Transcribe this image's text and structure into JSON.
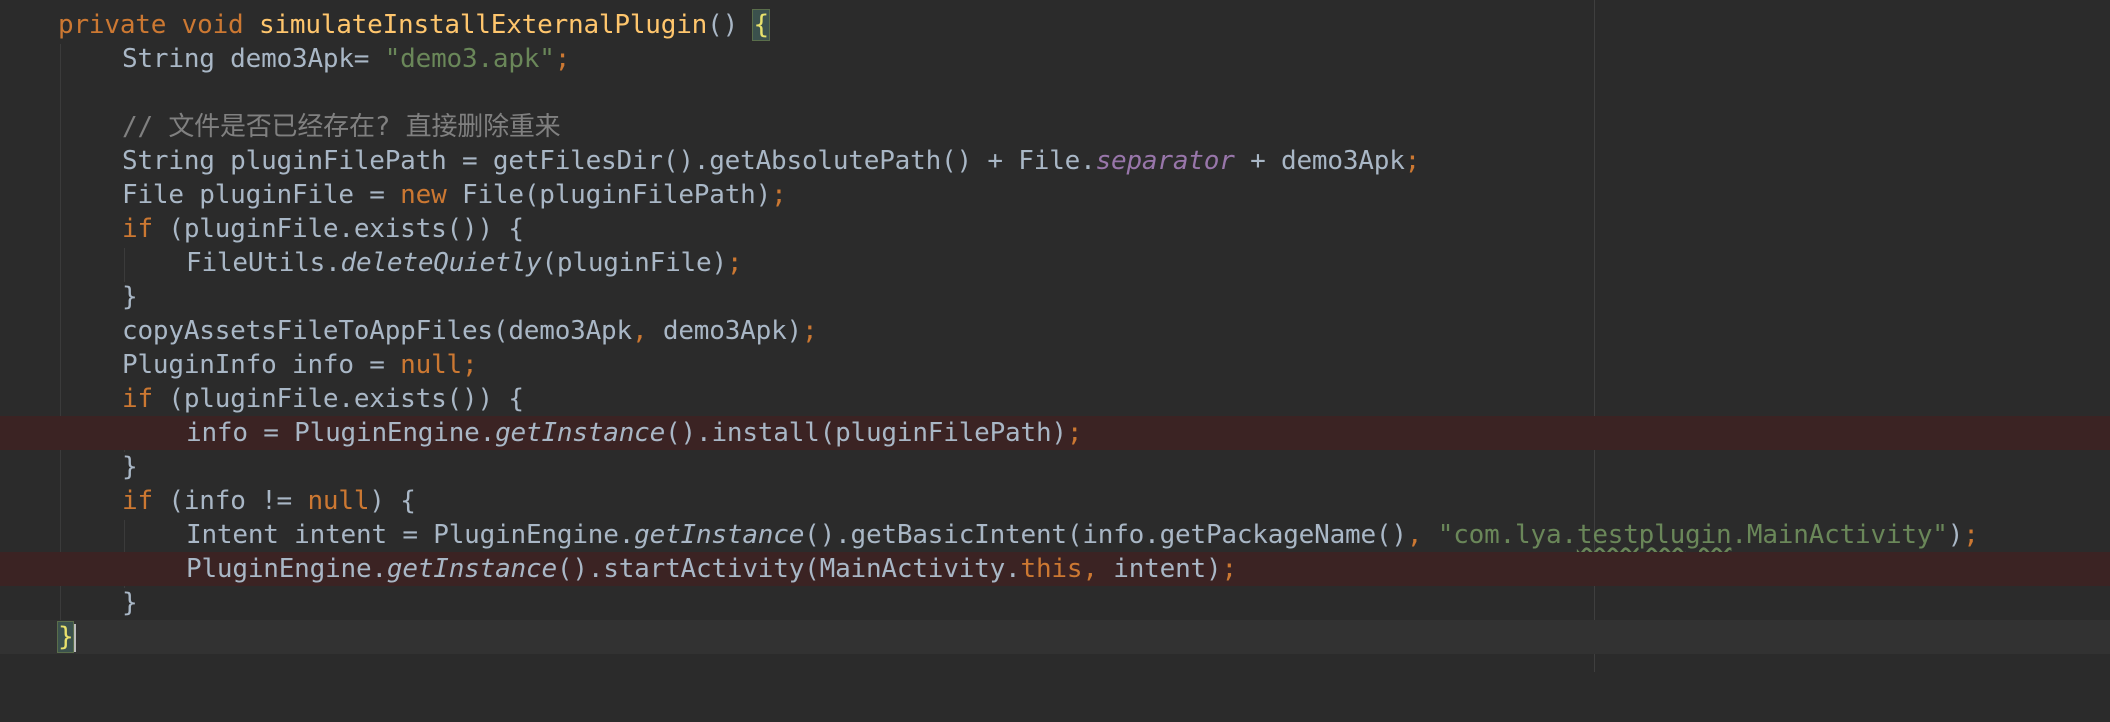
{
  "code": {
    "l1": {
      "mod": "private",
      "type": "void",
      "method": "simulateInstallExternalPlugin",
      "parens": "() ",
      "brace": "{"
    },
    "l2": {
      "a": "String demo3Apk= ",
      "str": "\"demo3.apk\"",
      "semi": ";"
    },
    "l4": {
      "comment": "// 文件是否已经存在? 直接删除重来"
    },
    "l5": {
      "a": "String pluginFilePath = getFilesDir().getAbsolutePath() + File.",
      "field": "separator",
      "b": " + demo3Apk",
      "semi": ";"
    },
    "l6": {
      "a": "File pluginFile = ",
      "kw": "new",
      "b": " File(pluginFilePath)",
      "semi": ";"
    },
    "l7": {
      "kw": "if",
      "b": " (pluginFile.exists()) {"
    },
    "l8": {
      "a": "FileUtils.",
      "it": "deleteQuietly",
      "b": "(pluginFile)",
      "semi": ";"
    },
    "l9": {
      "a": "}"
    },
    "l10": {
      "a": "copyAssetsFileToAppFiles(demo3Apk",
      "comma": ",",
      "b": " demo3Apk)",
      "semi": ";"
    },
    "l11": {
      "a": "PluginInfo info = ",
      "kw": "null",
      "semi": ";"
    },
    "l12": {
      "kw": "if",
      "b": " (pluginFile.exists()) {"
    },
    "l13": {
      "a": "info = PluginEngine.",
      "it": "getInstance",
      "b": "().install(pluginFilePath)",
      "semi": ";"
    },
    "l14": {
      "a": "}"
    },
    "l15": {
      "kw": "if",
      "b": " (info != ",
      "kw2": "null",
      "c": ") {"
    },
    "l16": {
      "a": "Intent intent = PluginEngine.",
      "it": "getInstance",
      "b": "().getBasicIntent(info.getPackageName()",
      "comma": ",",
      "str1": " \"com.lya.",
      "typo": "testplugin",
      "str2": ".MainActivity\"",
      "c": ")",
      "semi": ";"
    },
    "l17": {
      "a": "PluginEngine.",
      "it": "getInstance",
      "b": "().startActivity(MainActivity.",
      "kw": "this",
      "comma": ",",
      "c": " intent)",
      "semi": ";"
    },
    "l18": {
      "a": "}"
    },
    "l19": {
      "a": "}"
    }
  },
  "colors": {
    "background": "#2b2b2b",
    "keyword": "#cc7832",
    "method_declaration": "#ffc66d",
    "string": "#6a8759",
    "comment": "#808080",
    "static_field": "#9876aa",
    "default_text": "#a9b7c6",
    "breakpoint_line": "#3b2323"
  }
}
